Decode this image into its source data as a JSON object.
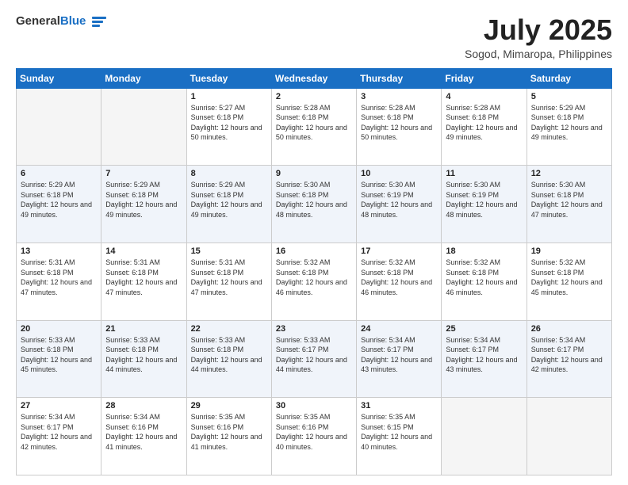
{
  "header": {
    "logo_general": "General",
    "logo_blue": "Blue",
    "month": "July 2025",
    "location": "Sogod, Mimaropa, Philippines"
  },
  "weekdays": [
    "Sunday",
    "Monday",
    "Tuesday",
    "Wednesday",
    "Thursday",
    "Friday",
    "Saturday"
  ],
  "weeks": [
    [
      {
        "day": "",
        "sunrise": "",
        "sunset": "",
        "daylight": ""
      },
      {
        "day": "",
        "sunrise": "",
        "sunset": "",
        "daylight": ""
      },
      {
        "day": "1",
        "sunrise": "Sunrise: 5:27 AM",
        "sunset": "Sunset: 6:18 PM",
        "daylight": "Daylight: 12 hours and 50 minutes."
      },
      {
        "day": "2",
        "sunrise": "Sunrise: 5:28 AM",
        "sunset": "Sunset: 6:18 PM",
        "daylight": "Daylight: 12 hours and 50 minutes."
      },
      {
        "day": "3",
        "sunrise": "Sunrise: 5:28 AM",
        "sunset": "Sunset: 6:18 PM",
        "daylight": "Daylight: 12 hours and 50 minutes."
      },
      {
        "day": "4",
        "sunrise": "Sunrise: 5:28 AM",
        "sunset": "Sunset: 6:18 PM",
        "daylight": "Daylight: 12 hours and 49 minutes."
      },
      {
        "day": "5",
        "sunrise": "Sunrise: 5:29 AM",
        "sunset": "Sunset: 6:18 PM",
        "daylight": "Daylight: 12 hours and 49 minutes."
      }
    ],
    [
      {
        "day": "6",
        "sunrise": "Sunrise: 5:29 AM",
        "sunset": "Sunset: 6:18 PM",
        "daylight": "Daylight: 12 hours and 49 minutes."
      },
      {
        "day": "7",
        "sunrise": "Sunrise: 5:29 AM",
        "sunset": "Sunset: 6:18 PM",
        "daylight": "Daylight: 12 hours and 49 minutes."
      },
      {
        "day": "8",
        "sunrise": "Sunrise: 5:29 AM",
        "sunset": "Sunset: 6:18 PM",
        "daylight": "Daylight: 12 hours and 49 minutes."
      },
      {
        "day": "9",
        "sunrise": "Sunrise: 5:30 AM",
        "sunset": "Sunset: 6:18 PM",
        "daylight": "Daylight: 12 hours and 48 minutes."
      },
      {
        "day": "10",
        "sunrise": "Sunrise: 5:30 AM",
        "sunset": "Sunset: 6:19 PM",
        "daylight": "Daylight: 12 hours and 48 minutes."
      },
      {
        "day": "11",
        "sunrise": "Sunrise: 5:30 AM",
        "sunset": "Sunset: 6:19 PM",
        "daylight": "Daylight: 12 hours and 48 minutes."
      },
      {
        "day": "12",
        "sunrise": "Sunrise: 5:30 AM",
        "sunset": "Sunset: 6:18 PM",
        "daylight": "Daylight: 12 hours and 47 minutes."
      }
    ],
    [
      {
        "day": "13",
        "sunrise": "Sunrise: 5:31 AM",
        "sunset": "Sunset: 6:18 PM",
        "daylight": "Daylight: 12 hours and 47 minutes."
      },
      {
        "day": "14",
        "sunrise": "Sunrise: 5:31 AM",
        "sunset": "Sunset: 6:18 PM",
        "daylight": "Daylight: 12 hours and 47 minutes."
      },
      {
        "day": "15",
        "sunrise": "Sunrise: 5:31 AM",
        "sunset": "Sunset: 6:18 PM",
        "daylight": "Daylight: 12 hours and 47 minutes."
      },
      {
        "day": "16",
        "sunrise": "Sunrise: 5:32 AM",
        "sunset": "Sunset: 6:18 PM",
        "daylight": "Daylight: 12 hours and 46 minutes."
      },
      {
        "day": "17",
        "sunrise": "Sunrise: 5:32 AM",
        "sunset": "Sunset: 6:18 PM",
        "daylight": "Daylight: 12 hours and 46 minutes."
      },
      {
        "day": "18",
        "sunrise": "Sunrise: 5:32 AM",
        "sunset": "Sunset: 6:18 PM",
        "daylight": "Daylight: 12 hours and 46 minutes."
      },
      {
        "day": "19",
        "sunrise": "Sunrise: 5:32 AM",
        "sunset": "Sunset: 6:18 PM",
        "daylight": "Daylight: 12 hours and 45 minutes."
      }
    ],
    [
      {
        "day": "20",
        "sunrise": "Sunrise: 5:33 AM",
        "sunset": "Sunset: 6:18 PM",
        "daylight": "Daylight: 12 hours and 45 minutes."
      },
      {
        "day": "21",
        "sunrise": "Sunrise: 5:33 AM",
        "sunset": "Sunset: 6:18 PM",
        "daylight": "Daylight: 12 hours and 44 minutes."
      },
      {
        "day": "22",
        "sunrise": "Sunrise: 5:33 AM",
        "sunset": "Sunset: 6:18 PM",
        "daylight": "Daylight: 12 hours and 44 minutes."
      },
      {
        "day": "23",
        "sunrise": "Sunrise: 5:33 AM",
        "sunset": "Sunset: 6:17 PM",
        "daylight": "Daylight: 12 hours and 44 minutes."
      },
      {
        "day": "24",
        "sunrise": "Sunrise: 5:34 AM",
        "sunset": "Sunset: 6:17 PM",
        "daylight": "Daylight: 12 hours and 43 minutes."
      },
      {
        "day": "25",
        "sunrise": "Sunrise: 5:34 AM",
        "sunset": "Sunset: 6:17 PM",
        "daylight": "Daylight: 12 hours and 43 minutes."
      },
      {
        "day": "26",
        "sunrise": "Sunrise: 5:34 AM",
        "sunset": "Sunset: 6:17 PM",
        "daylight": "Daylight: 12 hours and 42 minutes."
      }
    ],
    [
      {
        "day": "27",
        "sunrise": "Sunrise: 5:34 AM",
        "sunset": "Sunset: 6:17 PM",
        "daylight": "Daylight: 12 hours and 42 minutes."
      },
      {
        "day": "28",
        "sunrise": "Sunrise: 5:34 AM",
        "sunset": "Sunset: 6:16 PM",
        "daylight": "Daylight: 12 hours and 41 minutes."
      },
      {
        "day": "29",
        "sunrise": "Sunrise: 5:35 AM",
        "sunset": "Sunset: 6:16 PM",
        "daylight": "Daylight: 12 hours and 41 minutes."
      },
      {
        "day": "30",
        "sunrise": "Sunrise: 5:35 AM",
        "sunset": "Sunset: 6:16 PM",
        "daylight": "Daylight: 12 hours and 40 minutes."
      },
      {
        "day": "31",
        "sunrise": "Sunrise: 5:35 AM",
        "sunset": "Sunset: 6:15 PM",
        "daylight": "Daylight: 12 hours and 40 minutes."
      },
      {
        "day": "",
        "sunrise": "",
        "sunset": "",
        "daylight": ""
      },
      {
        "day": "",
        "sunrise": "",
        "sunset": "",
        "daylight": ""
      }
    ]
  ]
}
